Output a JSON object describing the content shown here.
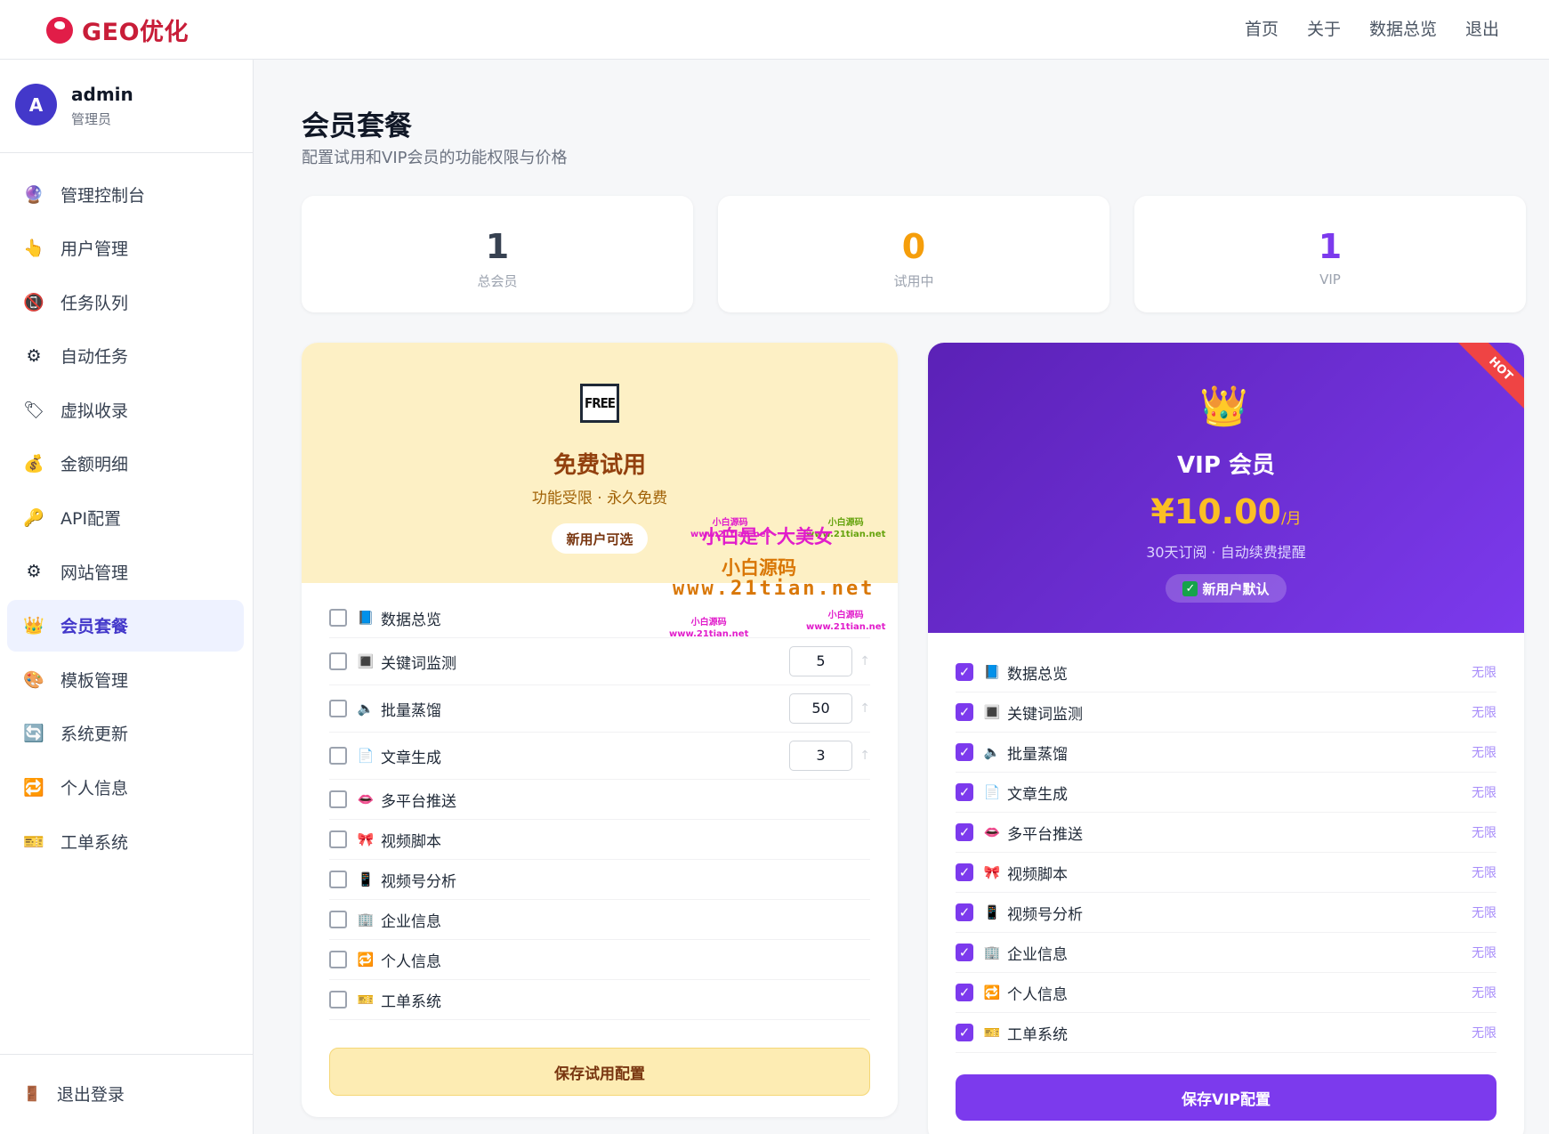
{
  "brand": {
    "name": "GEO优化",
    "logo_icon": "globe-icon"
  },
  "topnav": [
    "首页",
    "关于",
    "数据总览",
    "退出"
  ],
  "user": {
    "avatar_letter": "A",
    "name": "admin",
    "role": "管理员"
  },
  "sidebar": {
    "items": [
      {
        "label": "管理控制台",
        "icon": "🔮"
      },
      {
        "label": "用户管理",
        "icon": "👆"
      },
      {
        "label": "任务队列",
        "icon": "📵"
      },
      {
        "label": "自动任务",
        "icon": "⚙"
      },
      {
        "label": "虚拟收录",
        "icon": "🏷"
      },
      {
        "label": "金额明细",
        "icon": "💰"
      },
      {
        "label": "API配置",
        "icon": "🔑"
      },
      {
        "label": "网站管理",
        "icon": "⚙"
      },
      {
        "label": "会员套餐",
        "icon": "👑",
        "active": true
      },
      {
        "label": "模板管理",
        "icon": "🎨"
      },
      {
        "label": "系统更新",
        "icon": "🔄"
      },
      {
        "label": "个人信息",
        "icon": "🔁"
      },
      {
        "label": "工单系统",
        "icon": "🎫"
      }
    ],
    "logout": {
      "label": "退出登录",
      "icon": "🚪"
    }
  },
  "page": {
    "title": "会员套餐",
    "subtitle": "配置试用和VIP会员的功能权限与价格"
  },
  "stats": [
    {
      "value": "1",
      "label": "总会员",
      "color": "#374151"
    },
    {
      "value": "0",
      "label": "试用中",
      "color": "#f59e0b"
    },
    {
      "value": "1",
      "label": "VIP",
      "color": "#7c3aed"
    }
  ],
  "free_plan": {
    "icon": "FREE",
    "name": "免费试用",
    "desc": "功能受限 · 永久免费",
    "badge": "新用户可选",
    "features": [
      {
        "label": "数据总览",
        "icon": "📘",
        "checked": false
      },
      {
        "label": "关键词监测",
        "icon": "🔳",
        "checked": false,
        "qty": "5"
      },
      {
        "label": "批量蒸馏",
        "icon": "🔈",
        "checked": false,
        "qty": "50"
      },
      {
        "label": "文章生成",
        "icon": "📄",
        "checked": false,
        "qty": "3"
      },
      {
        "label": "多平台推送",
        "icon": "👄",
        "checked": false
      },
      {
        "label": "视频脚本",
        "icon": "🎀",
        "checked": false
      },
      {
        "label": "视频号分析",
        "icon": "📱",
        "checked": false
      },
      {
        "label": "企业信息",
        "icon": "🏢",
        "checked": false
      },
      {
        "label": "个人信息",
        "icon": "🔁",
        "checked": false
      },
      {
        "label": "工单系统",
        "icon": "🎫",
        "checked": false
      }
    ],
    "save_label": "保存试用配置",
    "qty_arrow": "↑"
  },
  "vip_plan": {
    "icon": "👑",
    "name": "VIP 会员",
    "price": "¥10.00",
    "unit": "/月",
    "desc": "30天订阅 · 自动续费提醒",
    "badge": "新用户默认",
    "ribbon": "HOT",
    "unlimited_label": "无限",
    "features": [
      {
        "label": "数据总览",
        "icon": "📘",
        "checked": true
      },
      {
        "label": "关键词监测",
        "icon": "🔳",
        "checked": true
      },
      {
        "label": "批量蒸馏",
        "icon": "🔈",
        "checked": true
      },
      {
        "label": "文章生成",
        "icon": "📄",
        "checked": true
      },
      {
        "label": "多平台推送",
        "icon": "👄",
        "checked": true
      },
      {
        "label": "视频脚本",
        "icon": "🎀",
        "checked": true
      },
      {
        "label": "视频号分析",
        "icon": "📱",
        "checked": true
      },
      {
        "label": "企业信息",
        "icon": "🏢",
        "checked": true
      },
      {
        "label": "个人信息",
        "icon": "🔁",
        "checked": true
      },
      {
        "label": "工单系统",
        "icon": "🎫",
        "checked": true
      }
    ],
    "save_label": "保存VIP配置"
  },
  "watermark": {
    "small_a": "小白源码",
    "small_a_url": "www.21tian.net",
    "small_b": "小白源码",
    "small_b_url": "www.21tian.net",
    "line1": "小白是个大美女",
    "line2": "小白源码",
    "line3": "www.21tian.net"
  }
}
